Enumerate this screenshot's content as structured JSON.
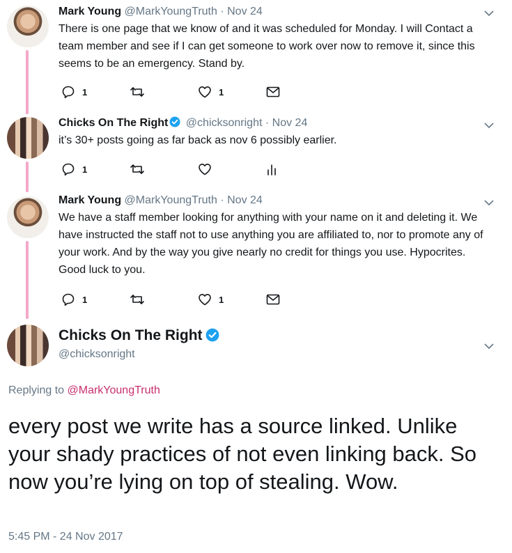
{
  "tweets": [
    {
      "name": "Mark Young",
      "handle": "@MarkYoungTruth",
      "date": "· Nov 24",
      "text": "There is one page that we know of and it was scheduled for Monday. I will Contact a team member and see if I can get someone to work over now to remove it, since this seems to be an emergency. Stand by.",
      "reply_count": "1",
      "like_count": "1"
    },
    {
      "name": "Chicks On The Right",
      "handle": "@chicksonright",
      "date": "· Nov 24",
      "text": "it’s 30+ posts going as far back as nov 6 possibly earlier.",
      "reply_count": "1"
    },
    {
      "name": "Mark Young",
      "handle": "@MarkYoungTruth",
      "date": "· Nov 24",
      "text": "We have a staff member looking for anything with your name on it and deleting it. We have instructed the staff not to use anything you are affiliated to, nor to promote any of your work.  And by the way you give nearly no credit for things you use. Hypocrites. Good luck to you.",
      "reply_count": "1",
      "like_count": "1"
    }
  ],
  "main_tweet": {
    "name": "Chicks On The Right",
    "handle": "@chicksonright",
    "replying_prefix": "Replying to",
    "replying_to": "@MarkYoungTruth",
    "text": "every post we write has a source linked. Unlike your shady practices of not even linking back. So now you’re lying on top of stealing. Wow.",
    "timestamp": "5:45 PM - 24 Nov 2017"
  },
  "colors": {
    "thread_line": "#f4a7c8",
    "verified": "#1da1f2",
    "link": "#c72f6e",
    "muted": "#657786"
  }
}
